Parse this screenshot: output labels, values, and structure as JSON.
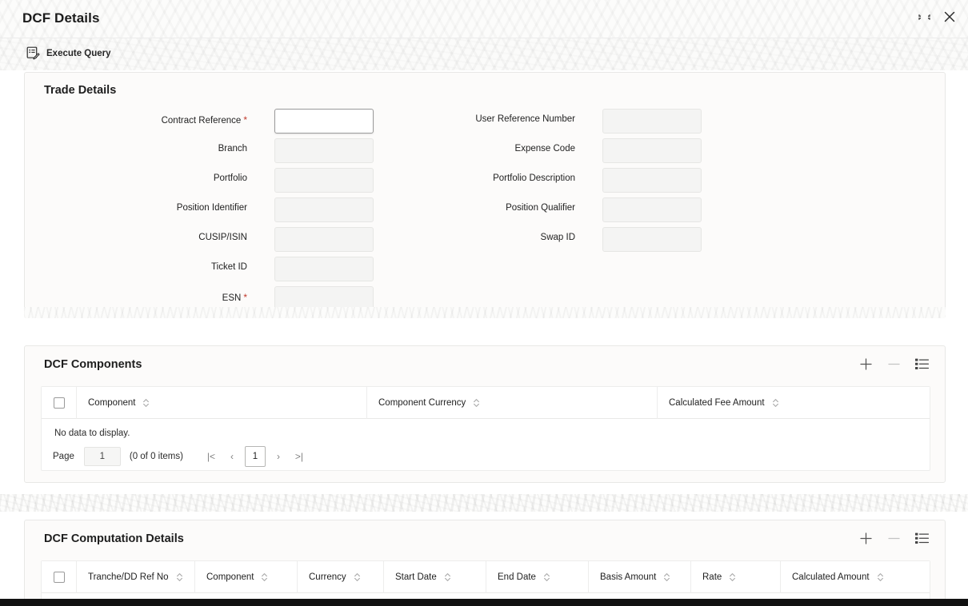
{
  "window": {
    "title": "DCF Details",
    "minimize_icon": "collapse-corners-icon",
    "close_icon": "close-icon"
  },
  "toolbar": {
    "execute_query_label": "Execute Query",
    "execute_query_icon": "form-edit-icon"
  },
  "trade_details": {
    "title": "Trade Details",
    "left_fields": [
      {
        "label": "Contract Reference",
        "required": true,
        "value": "",
        "active": true
      },
      {
        "label": "Branch",
        "required": false,
        "value": "",
        "active": false
      },
      {
        "label": "Portfolio",
        "required": false,
        "value": "",
        "active": false
      },
      {
        "label": "Position Identifier",
        "required": false,
        "value": "",
        "active": false
      },
      {
        "label": "CUSIP/ISIN",
        "required": false,
        "value": "",
        "active": false
      },
      {
        "label": "Ticket ID",
        "required": false,
        "value": "",
        "active": false
      },
      {
        "label": "ESN",
        "required": true,
        "value": "",
        "active": false
      }
    ],
    "right_fields": [
      {
        "label": "User Reference Number",
        "required": false,
        "value": "",
        "active": false
      },
      {
        "label": "Expense Code",
        "required": false,
        "value": "",
        "active": false
      },
      {
        "label": "Portfolio Description",
        "required": false,
        "value": "",
        "active": false
      },
      {
        "label": "Position Qualifier",
        "required": false,
        "value": "",
        "active": false
      },
      {
        "label": "Swap ID",
        "required": false,
        "value": "",
        "active": false
      }
    ],
    "required_marker": "*"
  },
  "dcf_components": {
    "title": "DCF Components",
    "tools": {
      "add": "plus-icon",
      "remove": "minus-icon",
      "list": "list-view-icon"
    },
    "columns": [
      "Component",
      "Component Currency",
      "Calculated Fee Amount"
    ],
    "rows": [],
    "empty_message": "No data to display.",
    "pager": {
      "page_label": "Page",
      "page_value": "1",
      "items_text": "(0 of 0 items)",
      "first": "|<",
      "prev": "‹",
      "current": "1",
      "next": "›",
      "last": ">|"
    }
  },
  "dcf_computation_details": {
    "title": "DCF Computation Details",
    "tools": {
      "add": "plus-icon",
      "remove": "minus-icon",
      "list": "list-view-icon"
    },
    "columns": [
      "Tranche/DD Ref No",
      "Component",
      "Currency",
      "Start Date",
      "End Date",
      "Basis Amount",
      "Rate",
      "Calculated Amount"
    ],
    "rows": []
  },
  "colors": {
    "required_star": "#c0392b",
    "panel_bg": "#fcfbfa",
    "active_field_bg": "#ffffff",
    "disabled_field_bg": "#f4f4f3",
    "text": "#1e1e1e"
  }
}
